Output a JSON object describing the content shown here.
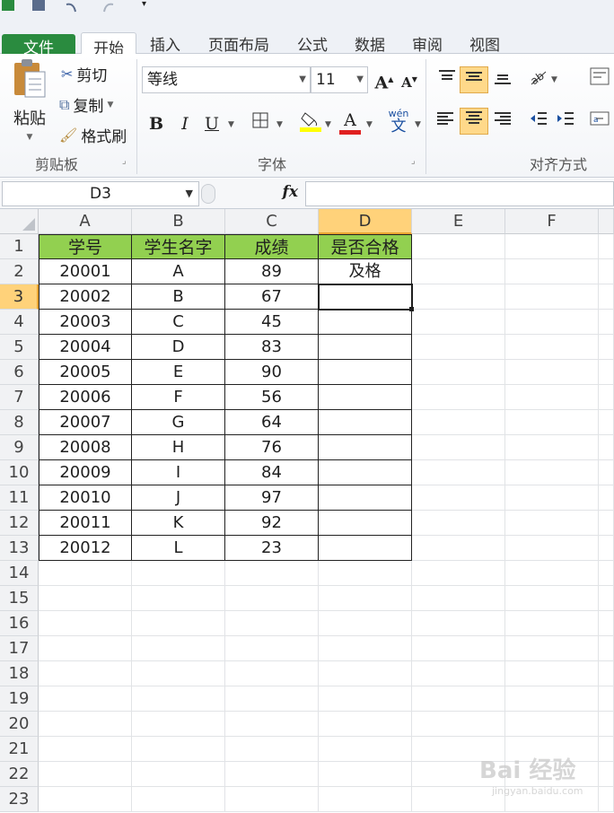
{
  "tabs": [
    {
      "label": "文件"
    },
    {
      "label": "开始"
    },
    {
      "label": "插入"
    },
    {
      "label": "页面布局"
    },
    {
      "label": "公式"
    },
    {
      "label": "数据"
    },
    {
      "label": "审阅"
    },
    {
      "label": "视图"
    }
  ],
  "clipboard": {
    "paste": "粘贴",
    "cut": "剪切",
    "copy": "复制",
    "format_painter": "格式刷",
    "group_label": "剪贴板"
  },
  "font": {
    "name": "等线",
    "size": "11",
    "bold": "B",
    "italic": "I",
    "underline": "U",
    "group_label": "字体",
    "wen_label": "wén",
    "wen_char": "文",
    "font_color_letter": "A",
    "grow_label": "A",
    "shrink_label": "A"
  },
  "alignment": {
    "group_label": "对齐方式"
  },
  "formula_bar": {
    "name_box": "D3",
    "fx": "fx",
    "content": ""
  },
  "sheet": {
    "columns": [
      "A",
      "B",
      "C",
      "D",
      "E",
      "F"
    ],
    "active_column": "D",
    "active_row": 3,
    "row_numbers": [
      "1",
      "2",
      "3",
      "4",
      "5",
      "6",
      "7",
      "8",
      "9",
      "10",
      "11",
      "12",
      "13",
      "14",
      "15",
      "16",
      "17",
      "18",
      "19",
      "20",
      "21",
      "22",
      "23"
    ],
    "header": [
      "学号",
      "学生名字",
      "成绩",
      "是否合格"
    ],
    "rows": [
      [
        "20001",
        "A",
        "89",
        "及格"
      ],
      [
        "20002",
        "B",
        "67",
        ""
      ],
      [
        "20003",
        "C",
        "45",
        ""
      ],
      [
        "20004",
        "D",
        "83",
        ""
      ],
      [
        "20005",
        "E",
        "90",
        ""
      ],
      [
        "20006",
        "F",
        "56",
        ""
      ],
      [
        "20007",
        "G",
        "64",
        ""
      ],
      [
        "20008",
        "H",
        "76",
        ""
      ],
      [
        "20009",
        "I",
        "84",
        ""
      ],
      [
        "20010",
        "J",
        "97",
        ""
      ],
      [
        "20011",
        "K",
        "92",
        ""
      ],
      [
        "20012",
        "L",
        "23",
        ""
      ]
    ]
  },
  "colors": {
    "header_fill": "#92d050",
    "file_tab": "#2a8b3f",
    "selection_highlight": "#ffd27a"
  },
  "watermark": {
    "brand": "Bai 经验",
    "url": "jingyan.baidu.com"
  }
}
